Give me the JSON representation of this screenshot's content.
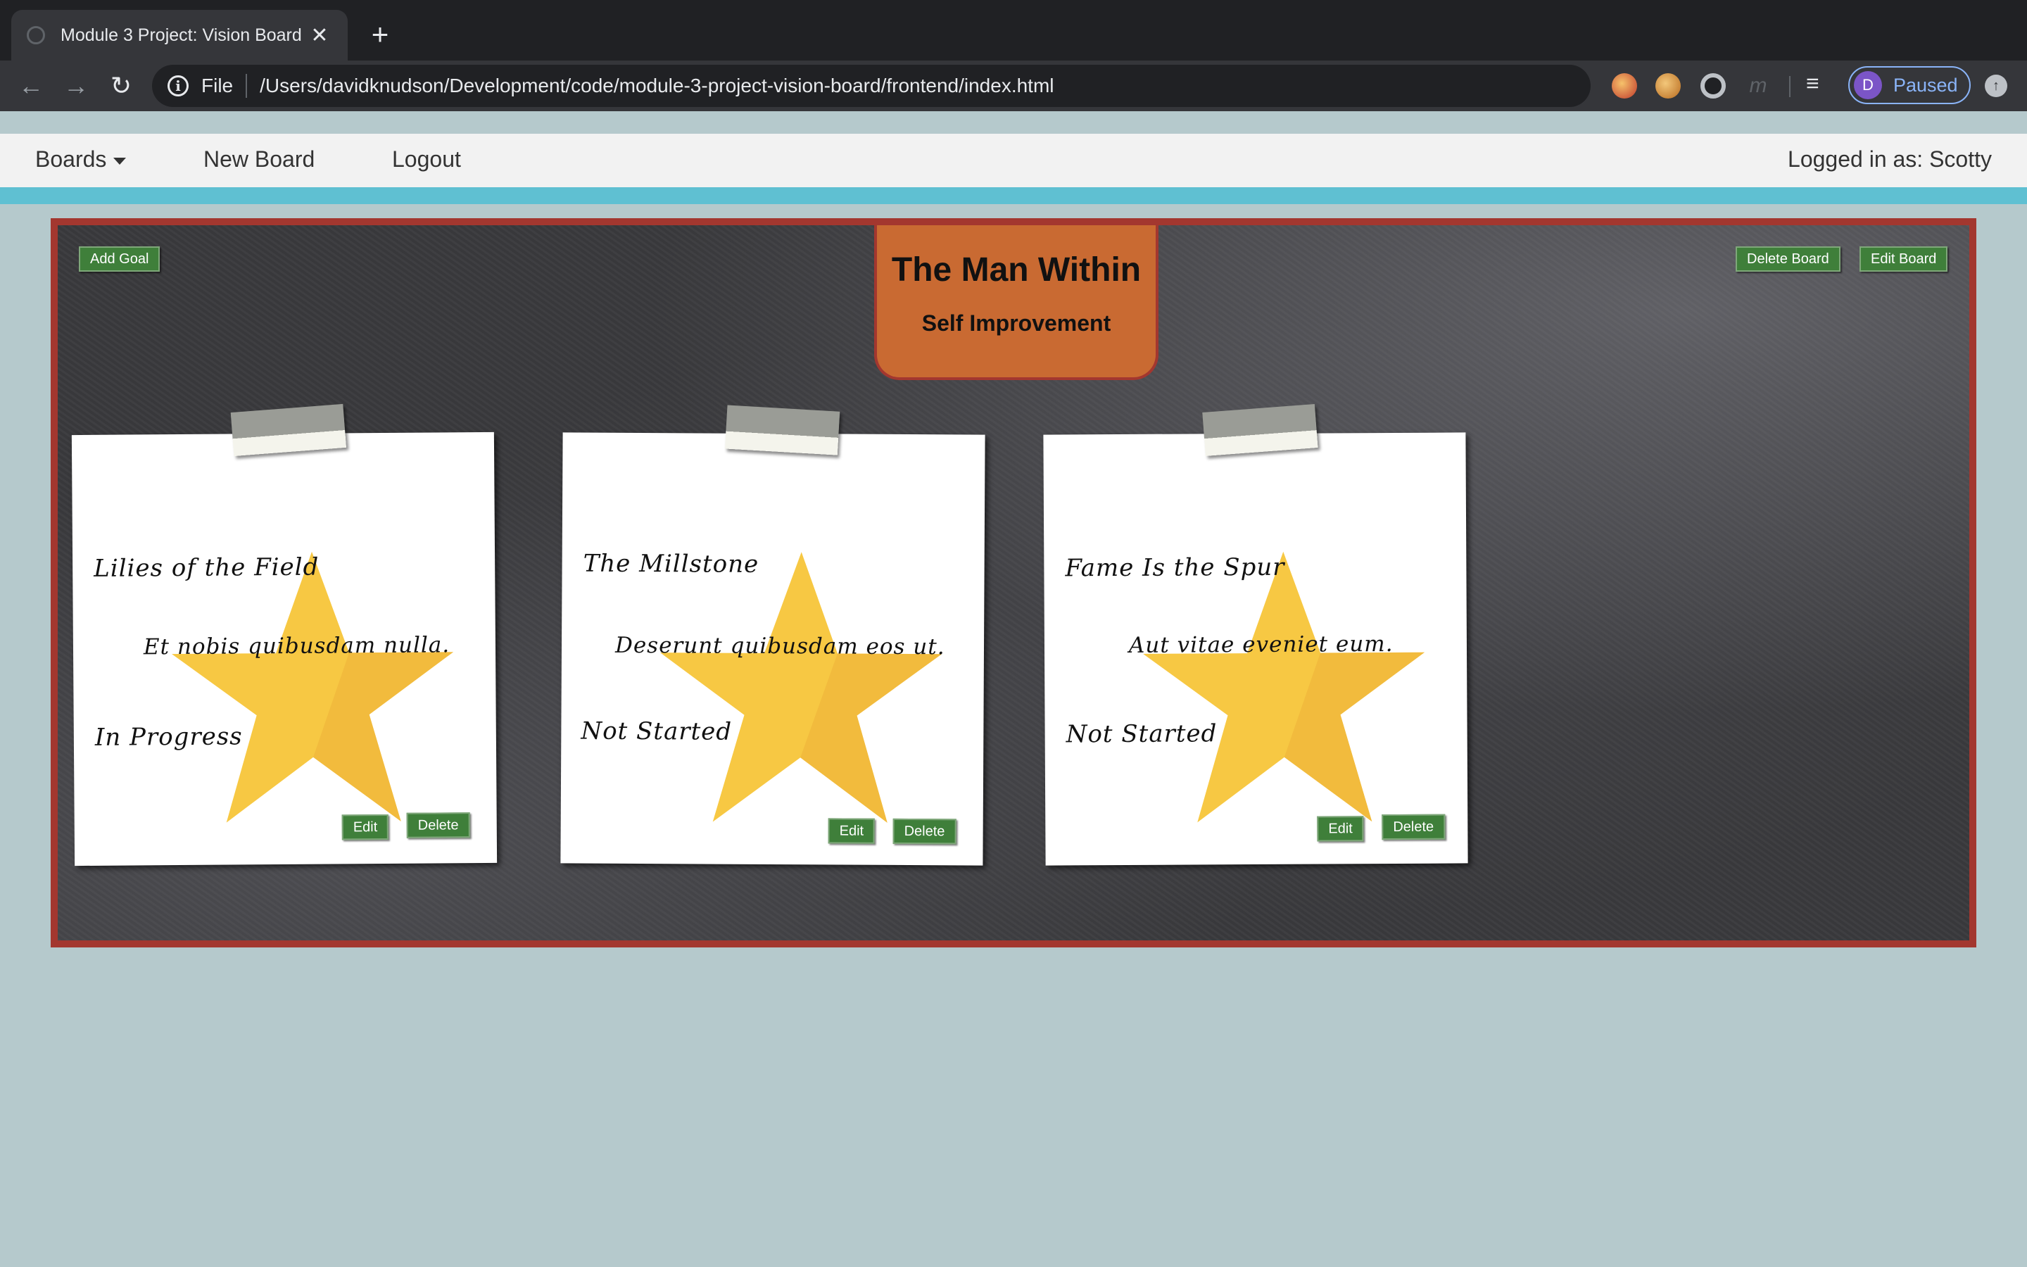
{
  "browser": {
    "tab_title": "Module 3 Project: Vision Board",
    "url_scheme": "File",
    "url": "/Users/davidknudson/Development/code/module-3-project-vision-board/frontend/index.html",
    "profile_initial": "D",
    "profile_status": "Paused"
  },
  "nav": {
    "boards_label": "Boards",
    "new_board_label": "New Board",
    "logout_label": "Logout",
    "logged_in": "Logged in as: Scotty"
  },
  "board": {
    "add_goal_label": "Add Goal",
    "delete_board_label": "Delete Board",
    "edit_board_label": "Edit Board",
    "title": "The Man Within",
    "category": "Self Improvement",
    "border_color": "#a3372f",
    "title_tab_color": "#c96a32"
  },
  "goals": [
    {
      "title": "Lilies of the Field",
      "description": "Et nobis quibusdam nulla.",
      "status": "In Progress",
      "edit_label": "Edit",
      "delete_label": "Delete"
    },
    {
      "title": "The Millstone",
      "description": "Deserunt quibusdam eos ut.",
      "status": "Not Started",
      "edit_label": "Edit",
      "delete_label": "Delete"
    },
    {
      "title": "Fame Is the Spur",
      "description": "Aut vitae eveniet eum.",
      "status": "Not Started",
      "edit_label": "Edit",
      "delete_label": "Delete"
    }
  ],
  "icons": {
    "tab": "globe-icon",
    "close": "close-icon",
    "new_tab": "plus-icon",
    "back": "back-arrow-icon",
    "forward": "forward-arrow-icon",
    "reload": "reload-icon",
    "info": "info-icon",
    "bookmark": "star-icon",
    "goal_image": "gold-star-icon"
  }
}
